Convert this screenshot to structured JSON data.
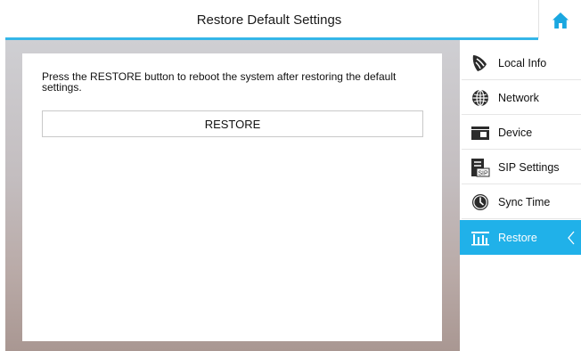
{
  "header": {
    "title": "Restore Default Settings",
    "home_icon": "home-icon",
    "accent_color": "#35b6e8"
  },
  "main": {
    "description": "Press the RESTORE button to reboot the system after restoring the default settings.",
    "restore_button_label": "RESTORE"
  },
  "sidebar": {
    "active_color": "#20b1e9",
    "items": [
      {
        "label": "Local Info",
        "icon": "local-info-icon",
        "active": false
      },
      {
        "label": "Network",
        "icon": "globe-icon",
        "active": false
      },
      {
        "label": "Device",
        "icon": "device-icon",
        "active": false
      },
      {
        "label": "SIP Settings",
        "icon": "sip-settings-icon",
        "active": false
      },
      {
        "label": "Sync Time",
        "icon": "clock-icon",
        "active": false
      },
      {
        "label": "Restore",
        "icon": "restore-icon",
        "active": true
      }
    ]
  }
}
